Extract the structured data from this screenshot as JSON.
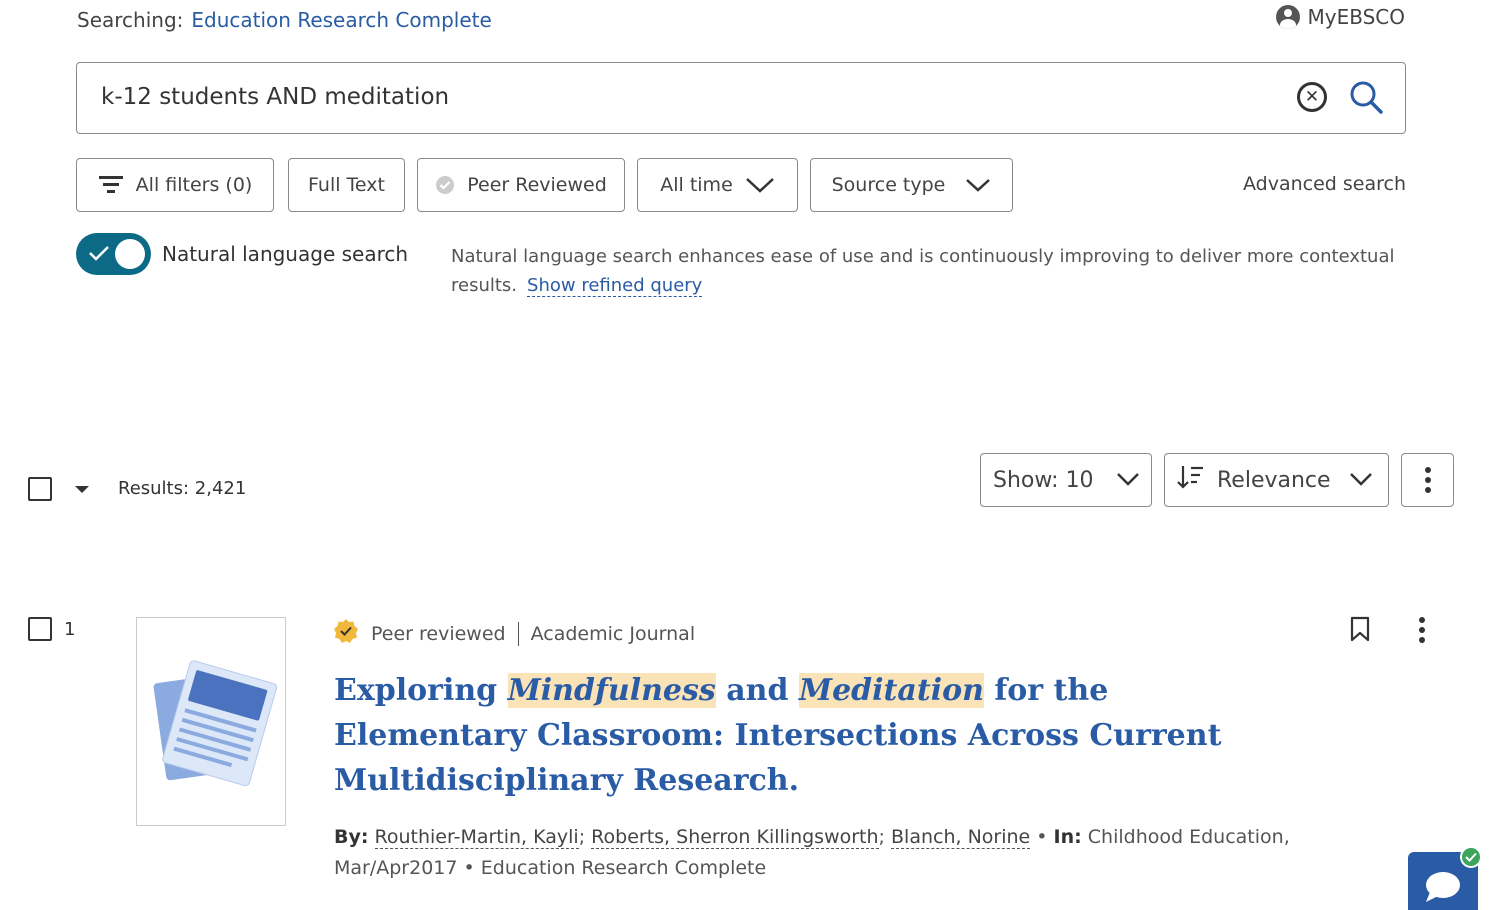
{
  "header": {
    "searching_label": "Searching:",
    "database": "Education Research Complete",
    "account": "MyEBSCO"
  },
  "search": {
    "query": "k-12 students AND meditation"
  },
  "filters": {
    "all_filters": "All filters (0)",
    "full_text": "Full Text",
    "peer_reviewed": "Peer Reviewed",
    "all_time": "All time",
    "source_type": "Source type",
    "advanced": "Advanced search"
  },
  "nls": {
    "label": "Natural language search",
    "enabled": true,
    "description": "Natural language search enhances ease of use and is continuously improving to deliver more contextual results.",
    "link": "Show refined query"
  },
  "results": {
    "count": "Results: 2,421",
    "show": "Show: 10",
    "sort": "Relevance"
  },
  "items": [
    {
      "number": "1",
      "peer": "Peer reviewed",
      "type": "Academic Journal",
      "title_parts": [
        "Exploring ",
        "Mindfulness",
        " and ",
        "Meditation",
        " for the Elementary Classroom: Intersections Across Current Multidisciplinary Research."
      ],
      "by_label": "By:",
      "authors": [
        "Routhier-Martin, Kayli",
        "Roberts, Sherron Killingsworth",
        "Blanch, Norine"
      ],
      "in_label": "In:",
      "source": "Childhood Education, Mar/Apr2017",
      "database": "Education Research Complete"
    }
  ],
  "colors": {
    "link": "#2a5ba5",
    "toggle": "#0d6a86",
    "highlight": "#fbe3b8",
    "peer_badge": "#f0b93b"
  }
}
